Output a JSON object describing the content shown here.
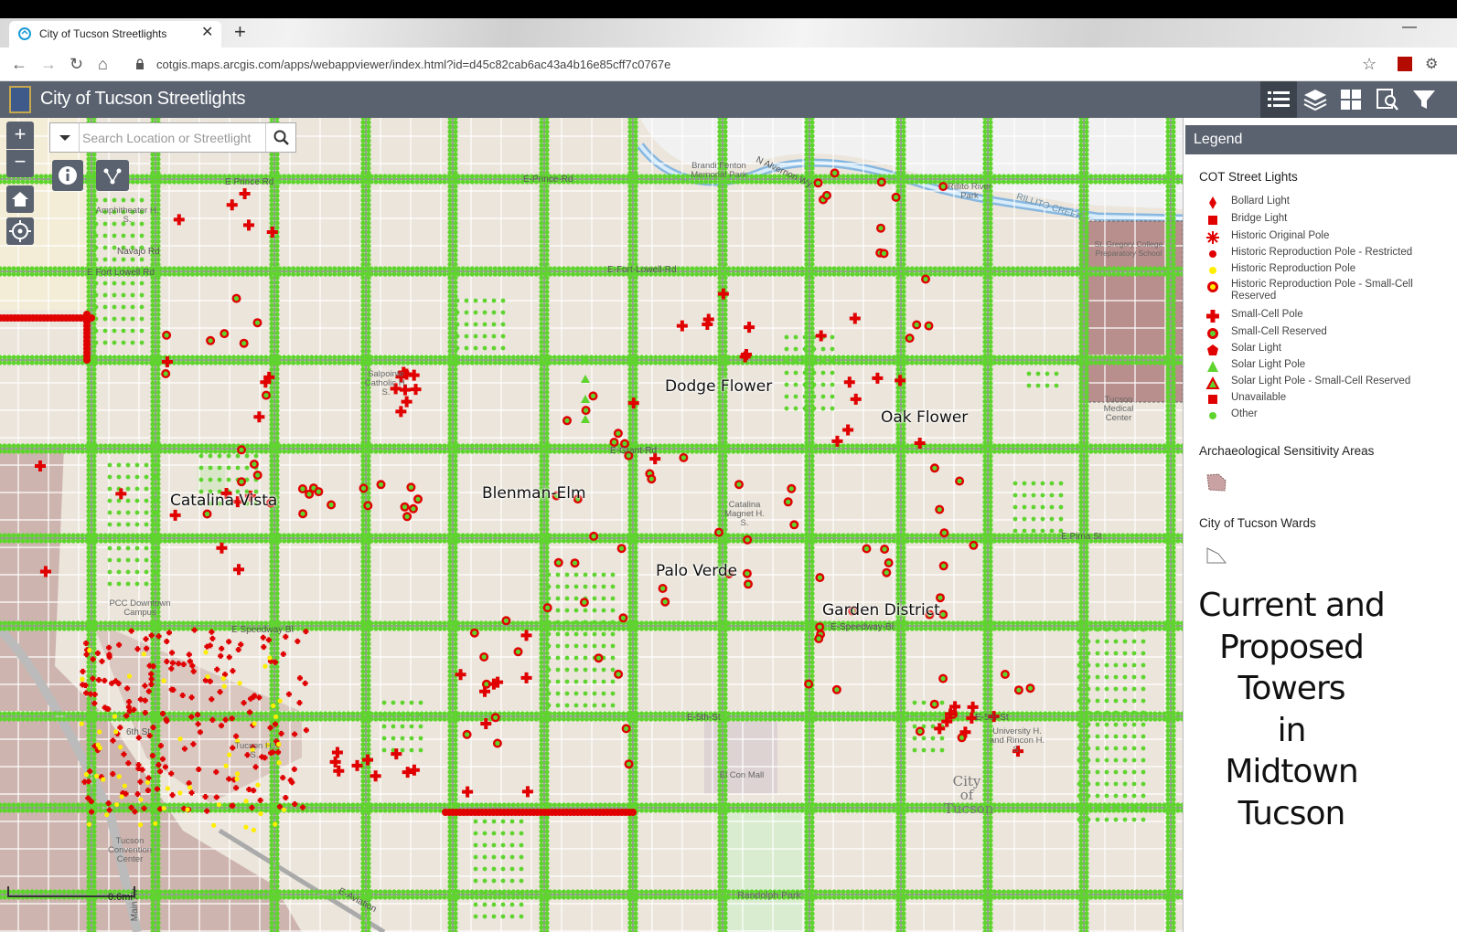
{
  "browser": {
    "tab_title": "City of Tucson Streetlights",
    "tab_close": "✕",
    "new_tab": "+",
    "minimize": "—",
    "url": "cotgis.maps.arcgis.com/apps/webappviewer/index.html?id=d45c82cab6ac43a4b16e85cff7c0767e",
    "back_icon": "←",
    "forward_icon": "→",
    "reload_icon": "↻",
    "home_icon": "⌂",
    "star_icon": "☆",
    "puzzle_icon": "⚙"
  },
  "app": {
    "title": "City of Tucson Streetlights",
    "tools": [
      "legend-list-icon",
      "layers-icon",
      "basemap-grid-icon",
      "query-icon",
      "filter-icon"
    ]
  },
  "map_controls": {
    "zoom_in": "+",
    "zoom_out": "−",
    "search_placeholder": "Search Location or Streetlight"
  },
  "map": {
    "area_labels": [
      "Dodge Flower",
      "Oak Flower",
      "Catalina Vista",
      "Blenman-Elm",
      "Palo Verde",
      "Garden District"
    ],
    "street_labels": [
      "E Prince Rd",
      "E-Prince-Rd",
      "E Fort Lowell Rd",
      "E-Fort-Lowell-Rd",
      "E-Grant-Rd",
      "E Speedway Bl",
      "E-Speedway-Bl",
      "E-5th-St",
      "E-5th-St",
      "N Alvernon Wy",
      "E Pima St",
      "Navajo Rd",
      "6th St",
      "E-Aviation",
      "Main Av"
    ],
    "poi_labels": [
      "Brandi Fenton Memorial Park",
      "Rillito River Park",
      "St. Gregory College Preparatory School",
      "Amphitheater H. S.",
      "Salpointe Catholic H. S.",
      "Tucson Medical Center",
      "Catalina Magnet H. S.",
      "PCC Downtown Campus",
      "Tucson H. S.",
      "Tucson Convention Center",
      "El Con Mall",
      "University H. and Rincon H. S.",
      "Randolph Park",
      "City of Tucson",
      "RILLITO CREEK"
    ],
    "scale": "0.6mi"
  },
  "legend": {
    "title": "Legend",
    "groups": [
      {
        "name": "COT Street Lights",
        "items": [
          {
            "label": "Bollard Light",
            "symbol": "diamond",
            "color": "#e00000"
          },
          {
            "label": "Bridge Light",
            "symbol": "square",
            "color": "#e00000"
          },
          {
            "label": "Historic Original Pole",
            "symbol": "asterisk",
            "color": "#e00000"
          },
          {
            "label": "Historic Reproduction Pole - Restricted",
            "symbol": "dot",
            "color": "#e00000"
          },
          {
            "label": "Historic Reproduction Pole",
            "symbol": "dot",
            "color": "#ffee00"
          },
          {
            "label": "Historic Reproduction Pole - Small-Cell Reserved",
            "symbol": "ring",
            "color": "#ffee00"
          },
          {
            "label": "Small-Cell Pole",
            "symbol": "cross",
            "color": "#e00000"
          },
          {
            "label": "Small-Cell Reserved",
            "symbol": "ring",
            "color": "#5fd42e"
          },
          {
            "label": "Solar Light",
            "symbol": "pentagon",
            "color": "#e00000"
          },
          {
            "label": "Solar Light Pole",
            "symbol": "triangle",
            "color": "#5fd42e"
          },
          {
            "label": "Solar Light Pole - Small-Cell Reserved",
            "symbol": "triangle-ring",
            "color": "#5fd42e"
          },
          {
            "label": "Unavailable",
            "symbol": "square",
            "color": "#e00000"
          },
          {
            "label": "Other",
            "symbol": "dot",
            "color": "#5fd42e"
          }
        ]
      },
      {
        "name": "Archaeological Sensitivity Areas",
        "items": [
          {
            "label": "",
            "symbol": "hatched-polygon",
            "color": "#c9a3a3"
          }
        ]
      },
      {
        "name": "City of Tucson Wards",
        "items": [
          {
            "label": "",
            "symbol": "outline-polygon",
            "color": "#888888"
          }
        ]
      }
    ]
  },
  "overlay_caption": [
    "Current and",
    "Proposed",
    "Towers",
    "in",
    "Midtown",
    "Tucson"
  ],
  "colors": {
    "header_bg": "#5a6270",
    "map_base": "#ece6dc",
    "streetlight_other": "#5fd42e",
    "small_cell": "#e00000",
    "historic_repro": "#ffee00"
  }
}
